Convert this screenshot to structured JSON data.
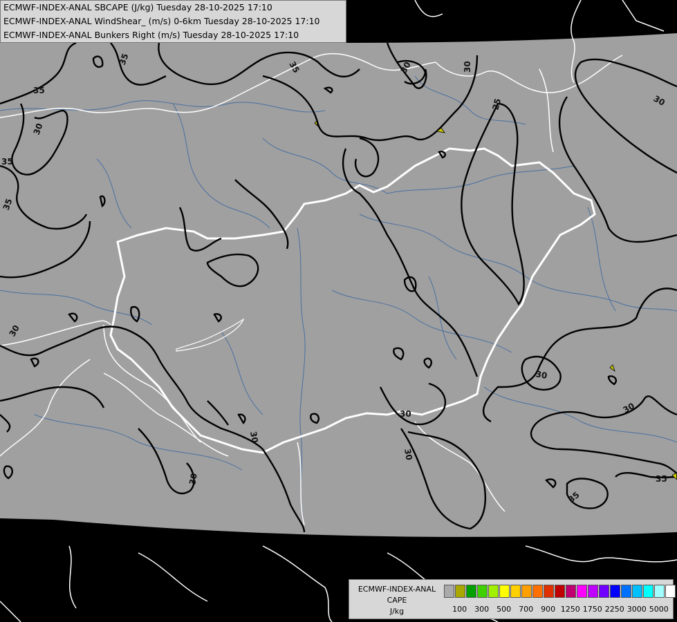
{
  "header": {
    "line1": "ECMWF-INDEX-ANAL SBCAPE (J/kg) Tuesday 28-10-2025 17:10",
    "line2": "ECMWF-INDEX-ANAL WindShear_ (m/s) 0-6km Tuesday 28-10-2025 17:10",
    "line3": "ECMWF-INDEX-ANAL Bunkers Right (m/s) Tuesday 28-10-2025 17:10"
  },
  "legend": {
    "title1": "ECMWF-INDEX-ANAL",
    "title2": "CAPE",
    "unit": "J/kg",
    "swatches": [
      "#aaaaaa",
      "#a8a800",
      "#00a000",
      "#40d000",
      "#a0f000",
      "#ffff00",
      "#ffd000",
      "#ffa000",
      "#ff7000",
      "#e03000",
      "#c00000",
      "#c00070",
      "#ff00ff",
      "#c000ff",
      "#7000ff",
      "#0000ff",
      "#0070ff",
      "#00c0ff",
      "#00ffff",
      "#a0ffff",
      "#ffffff"
    ],
    "labels": [
      "100",
      "300",
      "500",
      "700",
      "900",
      "1250",
      "1750",
      "2250",
      "3000",
      "5000"
    ]
  },
  "contour_labels": [
    "35",
    "35",
    "35",
    "35",
    "35",
    "30",
    "30",
    "30",
    "30",
    "30",
    "30",
    "30",
    "30",
    "30",
    "30",
    "30",
    "25",
    "35",
    "35"
  ],
  "colors": {
    "field": "#a0a0a0",
    "background": "#000000",
    "border": "#ffffff",
    "river": "#4a6fa0",
    "contour": "#000000"
  }
}
